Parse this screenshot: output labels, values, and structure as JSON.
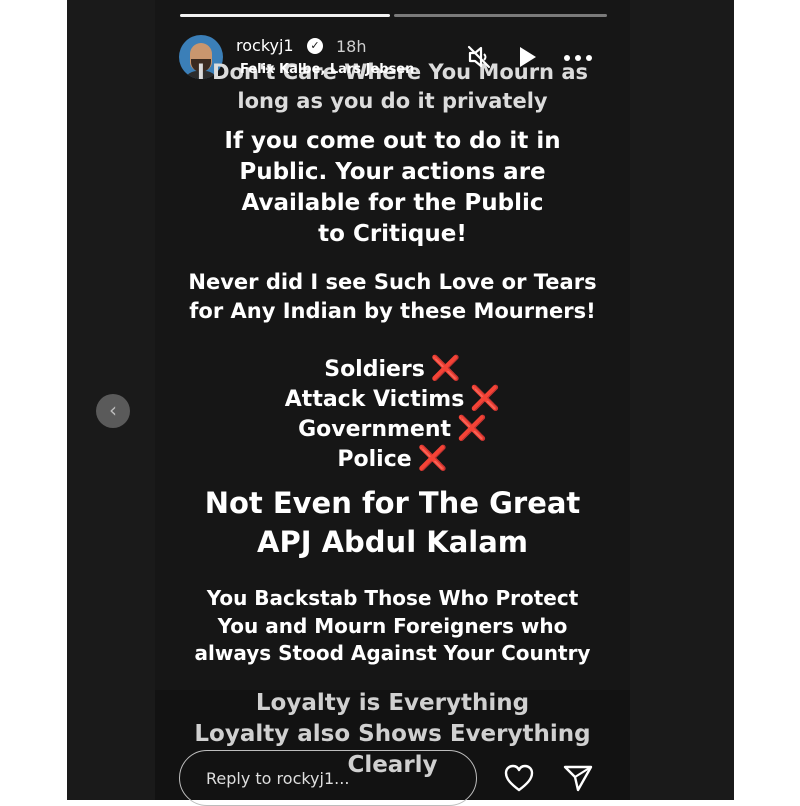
{
  "story": {
    "username": "rockyj1",
    "timestamp": "18h",
    "music_label": "Felix Kalbe, Lars Jebsen",
    "intro_lines": [
      "I Don't Care Where You Mourn as",
      "long as you do it privately"
    ],
    "public_lines": [
      "If you come out to do it in",
      "Public. Your actions are",
      "Available for the Public",
      "to Critique!"
    ],
    "never_lines": [
      "Never did I see Such Love or Tears",
      "for Any Indian by these Mourners!"
    ],
    "list_items": [
      "Soldiers",
      "Attack Victims",
      "Government",
      "Police"
    ],
    "list_mark": "❌",
    "kalam_lines": [
      "Not Even for The Great",
      "APJ Abdul Kalam"
    ],
    "backstab_lines": [
      "You Backstab Those Who Protect",
      "You and Mourn Foreigners who",
      "always Stood Against Your Country"
    ],
    "loyalty_lines": [
      "Loyalty is Everything",
      "Loyalty also Shows Everything",
      "Clearly"
    ]
  },
  "controls": {
    "reply_placeholder": "Reply to rockyj1...",
    "prev_glyph": "‹"
  },
  "icons": {
    "verified": "verified-badge-icon",
    "mute": "speaker-muted-icon",
    "play": "play-icon",
    "more": "more-dots-icon",
    "like": "heart-icon",
    "share": "paper-plane-icon"
  },
  "colors": {
    "story_background": "#161616",
    "text": "#ffffff",
    "cross_mark": "#e02424"
  }
}
